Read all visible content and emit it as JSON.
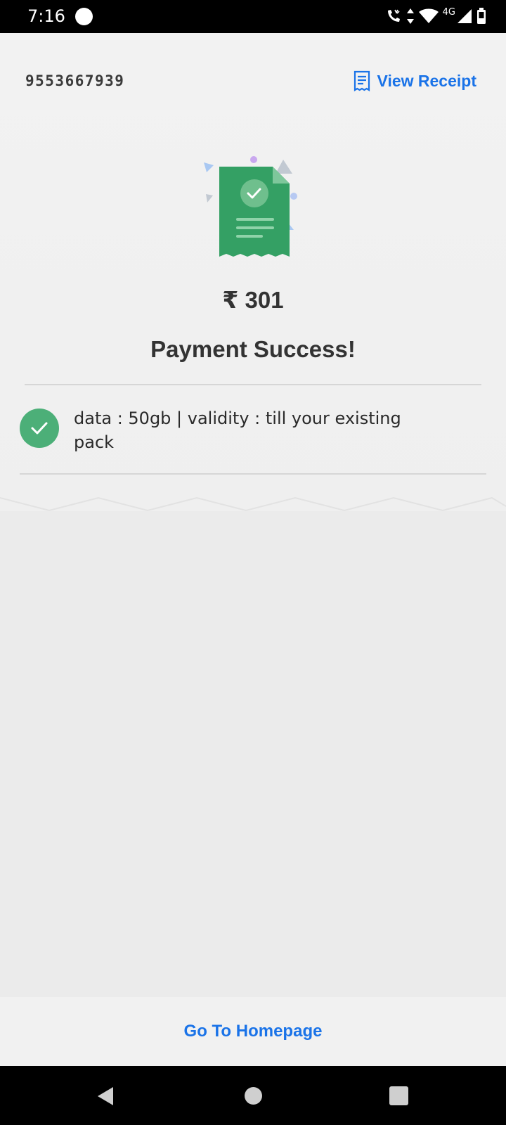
{
  "status_bar": {
    "time": "7:16",
    "network_label": "4G",
    "icons": [
      "wifi-call-icon",
      "data-arrows-icon",
      "wifi-icon",
      "signal-icon",
      "battery-icon"
    ]
  },
  "header": {
    "phone_number": "9553667939",
    "view_receipt_label": "View Receipt"
  },
  "payment": {
    "amount": "₹ 301",
    "status": "Payment Success!"
  },
  "benefits": [
    {
      "text": "data : 50gb | validity : till your existing pack"
    }
  ],
  "footer": {
    "home_label": "Go To Homepage"
  },
  "colors": {
    "accent": "#1a73e8",
    "success": "#4caf78",
    "receipt_green": "#34a064"
  }
}
